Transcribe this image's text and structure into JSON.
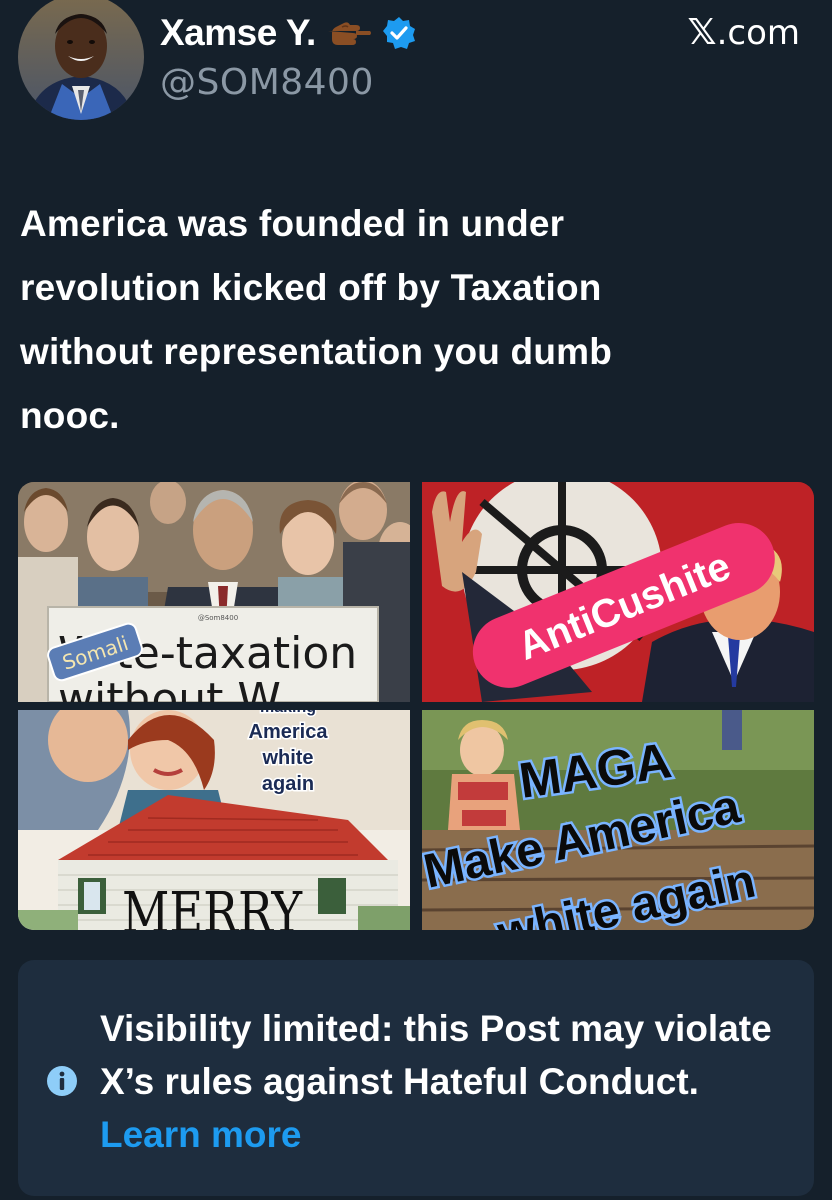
{
  "header": {
    "display_name": "Xamse Y.",
    "emoji_icon": "pointing-hand-emoji",
    "verified_icon": "verified-badge-icon",
    "handle": "@SOM8400",
    "site_x": "𝕏",
    "site_domain": ".com"
  },
  "post": {
    "text": "America was founded in under\nrevolution kicked off by Taxation\nwithout representation you dumb\nnooc."
  },
  "media": {
    "image1": {
      "sign_top": "@Som8400",
      "sign_text": "W  te-taxation",
      "sign_bottom": "without W",
      "sticker": "Somali"
    },
    "image2": {
      "sticker": "AntiCushite"
    },
    "image3": {
      "caption_top": "making",
      "caption_line1": "America",
      "caption_line2": "white",
      "caption_line3": "again",
      "overlay": "MERRY"
    },
    "image4": {
      "line1": "MAGA",
      "line2": "Make America",
      "line3": "white again"
    }
  },
  "notice": {
    "text": "Visibility limited: this Post may violate X’s rules against Hateful Conduct. ",
    "link": "Learn more",
    "icon": "info-icon"
  },
  "colors": {
    "background": "#15202b",
    "notice_bg": "#1e2d3e",
    "link": "#1d9bf0",
    "secondary_text": "#8b98a5",
    "verified": "#1d9bf0"
  }
}
